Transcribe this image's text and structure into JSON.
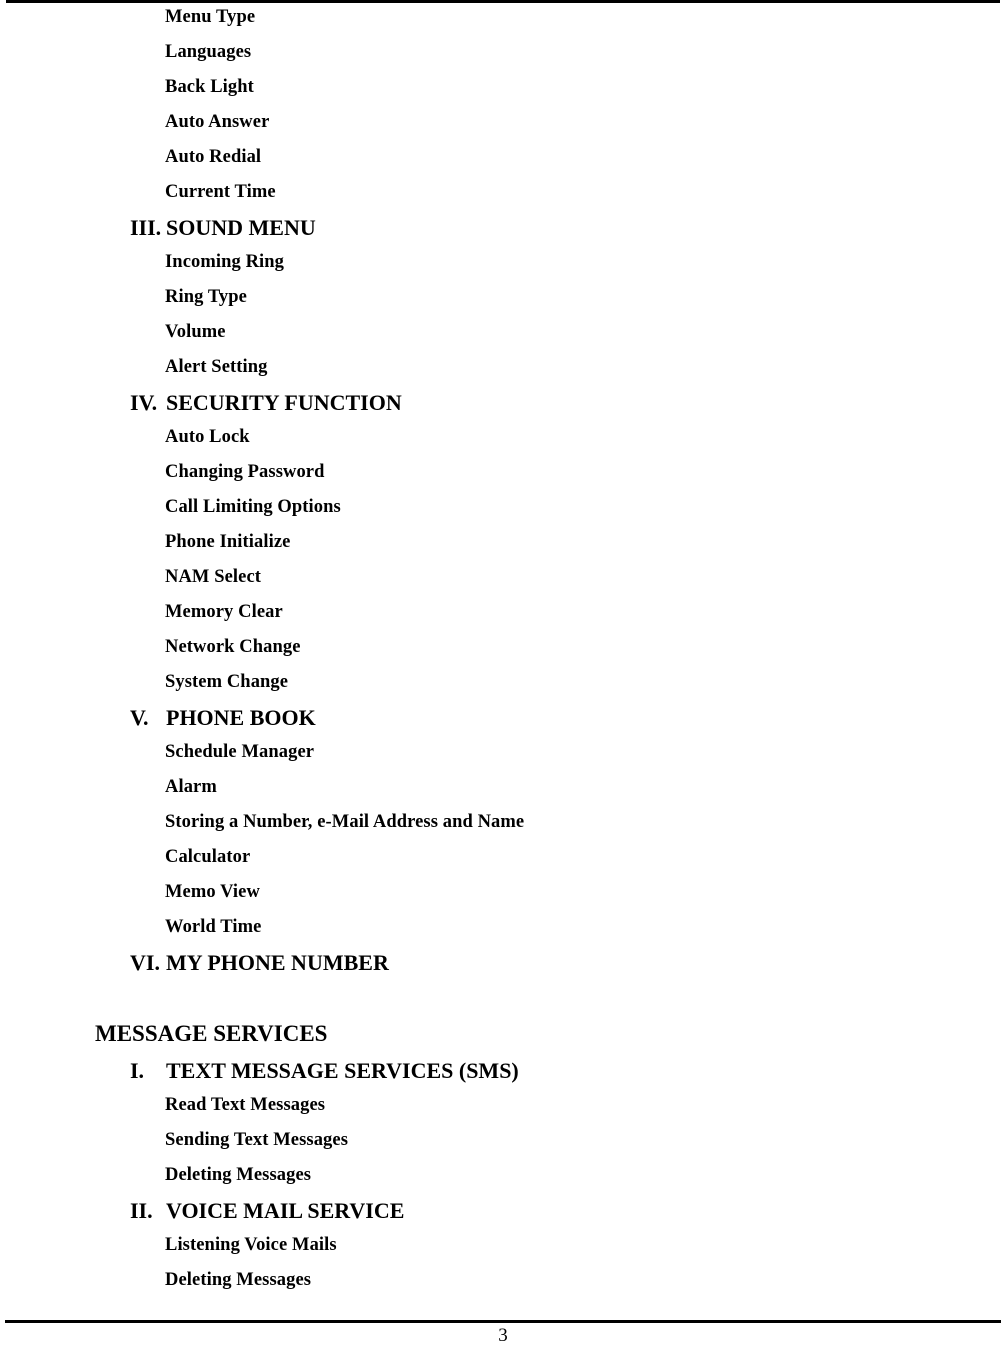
{
  "document": {
    "page_number": "3",
    "top_rule": true,
    "footer_rule": true
  },
  "contents": [
    {
      "kind": "sub",
      "label": "Menu Type"
    },
    {
      "kind": "sub",
      "label": "Languages"
    },
    {
      "kind": "sub",
      "label": "Back Light"
    },
    {
      "kind": "sub",
      "label": "Auto Answer"
    },
    {
      "kind": "sub",
      "label": "Auto Redial"
    },
    {
      "kind": "sub",
      "label": "Current Time"
    },
    {
      "kind": "section",
      "numeral": "III.",
      "label": "SOUND MENU"
    },
    {
      "kind": "sub",
      "label": "Incoming Ring"
    },
    {
      "kind": "sub",
      "label": "Ring Type"
    },
    {
      "kind": "sub",
      "label": "Volume"
    },
    {
      "kind": "sub",
      "label": "Alert Setting"
    },
    {
      "kind": "section",
      "numeral": "IV.",
      "label": "SECURITY FUNCTION"
    },
    {
      "kind": "sub",
      "label": "Auto Lock"
    },
    {
      "kind": "sub",
      "label": "Changing Password"
    },
    {
      "kind": "sub",
      "label": "Call Limiting Options"
    },
    {
      "kind": "sub",
      "label": "Phone Initialize"
    },
    {
      "kind": "sub",
      "label": "NAM Select"
    },
    {
      "kind": "sub",
      "label": "Memory Clear"
    },
    {
      "kind": "sub",
      "label": "Network Change"
    },
    {
      "kind": "sub",
      "label": "System Change"
    },
    {
      "kind": "section",
      "numeral": "V.",
      "label": "PHONE BOOK"
    },
    {
      "kind": "sub",
      "label": "Schedule Manager"
    },
    {
      "kind": "sub",
      "label": "Alarm"
    },
    {
      "kind": "sub",
      "label": "Storing a Number, e-Mail Address and Name"
    },
    {
      "kind": "sub",
      "label": "Calculator"
    },
    {
      "kind": "sub",
      "label": "Memo View"
    },
    {
      "kind": "sub",
      "label": "World Time"
    },
    {
      "kind": "section",
      "numeral": "VI.",
      "label": "MY PHONE NUMBER"
    },
    {
      "kind": "spacer",
      "label": ""
    },
    {
      "kind": "part",
      "label": "MESSAGE SERVICES"
    },
    {
      "kind": "section",
      "numeral": "I.",
      "label": "TEXT MESSAGE SERVICES (SMS)"
    },
    {
      "kind": "sub",
      "label": "Read Text Messages"
    },
    {
      "kind": "sub",
      "label": "Sending Text Messages"
    },
    {
      "kind": "sub",
      "label": "Deleting Messages"
    },
    {
      "kind": "section",
      "numeral": "II.",
      "label": "VOICE MAIL SERVICE"
    },
    {
      "kind": "sub",
      "label": "Listening Voice Mails"
    },
    {
      "kind": "sub",
      "label": "Deleting Messages"
    }
  ]
}
